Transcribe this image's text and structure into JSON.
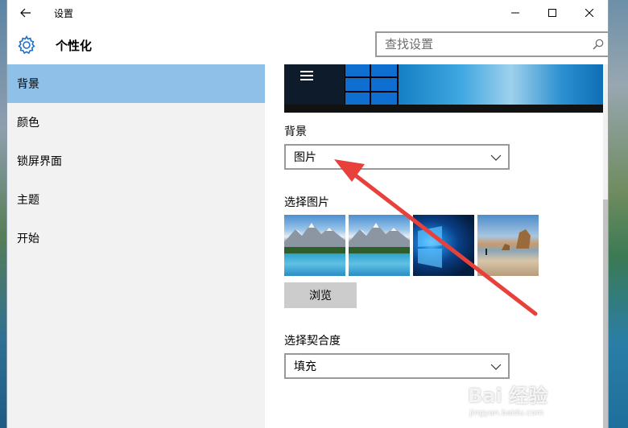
{
  "window": {
    "title": "设置"
  },
  "header": {
    "page_title": "个性化",
    "search_placeholder": "查找设置"
  },
  "sidebar": {
    "items": [
      {
        "label": "背景",
        "selected": true
      },
      {
        "label": "颜色",
        "selected": false
      },
      {
        "label": "锁屏界面",
        "selected": false
      },
      {
        "label": "主题",
        "selected": false
      },
      {
        "label": "开始",
        "selected": false
      }
    ]
  },
  "main": {
    "background_label": "背景",
    "background_value": "图片",
    "choose_picture_label": "选择图片",
    "browse_label": "浏览",
    "fit_label": "选择契合度",
    "fit_value": "填充"
  },
  "watermark": {
    "logo": "Bai 经验",
    "url": "jingyan.baidu.com"
  },
  "colors": {
    "selected_nav": "#8ec0e8",
    "annotation_arrow": "#e8403a"
  }
}
